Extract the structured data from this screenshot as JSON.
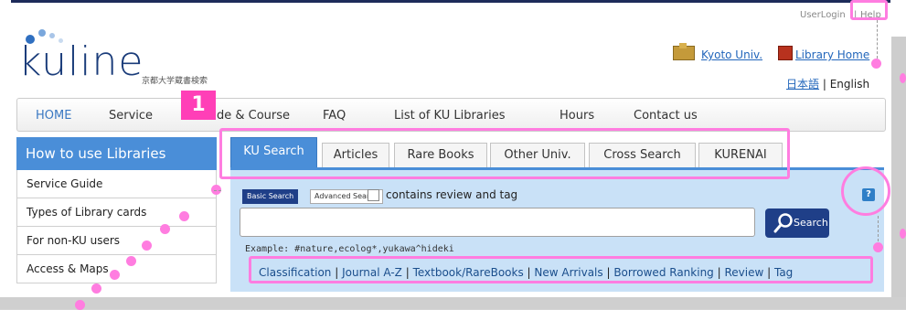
{
  "util_bar": {
    "login": "UserLogin",
    "separator": "|",
    "help": "Help"
  },
  "logo": {
    "word": "kuline",
    "subtitle": "京都大学蔵書検索"
  },
  "top_links": {
    "kyoto": "Kyoto Univ.",
    "library_home": "Library Home"
  },
  "language": {
    "japanese": "日本語",
    "separator": "|",
    "english": "English"
  },
  "nav": {
    "items": [
      {
        "label": "HOME"
      },
      {
        "label": "Service"
      },
      {
        "label": "de & Course"
      },
      {
        "label": "FAQ"
      },
      {
        "label": "List of KU Libraries"
      },
      {
        "label": "Hours"
      },
      {
        "label": "Contact us"
      }
    ]
  },
  "badge": {
    "number": "1"
  },
  "sidebar": {
    "title": "How to use Libraries",
    "items": [
      {
        "label": "Service Guide"
      },
      {
        "label": "Types of Library cards"
      },
      {
        "label": "For non-KU users"
      },
      {
        "label": "Access & Maps"
      }
    ]
  },
  "tabs": [
    {
      "label": "KU Search",
      "active": true
    },
    {
      "label": "Articles"
    },
    {
      "label": "Rare Books"
    },
    {
      "label": "Other Univ."
    },
    {
      "label": "Cross Search"
    },
    {
      "label": "KURENAI"
    }
  ],
  "search": {
    "basic_tab": "Basic Search",
    "advanced_tab": "Advanced Search",
    "review_checkbox": "contains review and tag",
    "input_value": "",
    "button_label": "Search",
    "example": "Example: #nature,ecolog*,yukawa^hideki",
    "help_icon": "?"
  },
  "quick_links": [
    {
      "label": "Classification"
    },
    {
      "label": "Journal A-Z"
    },
    {
      "label": "Textbook/RareBooks"
    },
    {
      "label": "New Arrivals"
    },
    {
      "label": "Borrowed Ranking"
    },
    {
      "label": "Review"
    },
    {
      "label": "Tag"
    }
  ],
  "colors": {
    "accent": "#4a8ed8",
    "highlight": "#ff7de0",
    "badge": "#ff3fb7",
    "search_button": "#1f3f88",
    "panel": "#c9e1f7"
  }
}
